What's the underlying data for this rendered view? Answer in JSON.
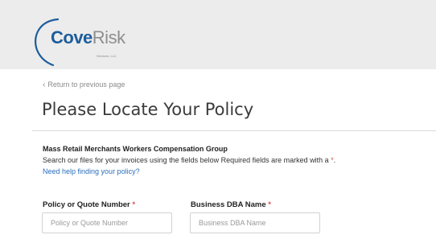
{
  "header": {
    "logo": {
      "name_part1": "Cove",
      "name_part2": "Risk",
      "subtitle": "Services, LLC",
      "icon": "arc-swoosh-logo"
    }
  },
  "nav": {
    "back_icon": "chevron-left-icon",
    "back_label": "Return to previous page"
  },
  "page": {
    "title": "Please Locate Your Policy",
    "group_name": "Mass Retail Merchants Workers Compensation Group",
    "instructions": "Search our files for your invoices using the fields below  Required fields are marked with a",
    "required_marker": "*",
    "instructions_end": ".",
    "help_link": "Need help finding your policy?"
  },
  "form": {
    "policy": {
      "label": "Policy or Quote Number",
      "required": "*",
      "placeholder": "Policy or Quote Number",
      "value": ""
    },
    "dba": {
      "label": "Business DBA Name",
      "required": "*",
      "placeholder": "Business DBA Name",
      "value": ""
    }
  },
  "colors": {
    "header_bg": "#ececec",
    "brand_blue": "#1d5d9b",
    "brand_gray": "#8e8e8e",
    "link_blue": "#2a6ebb",
    "required_red": "#d9534f"
  }
}
